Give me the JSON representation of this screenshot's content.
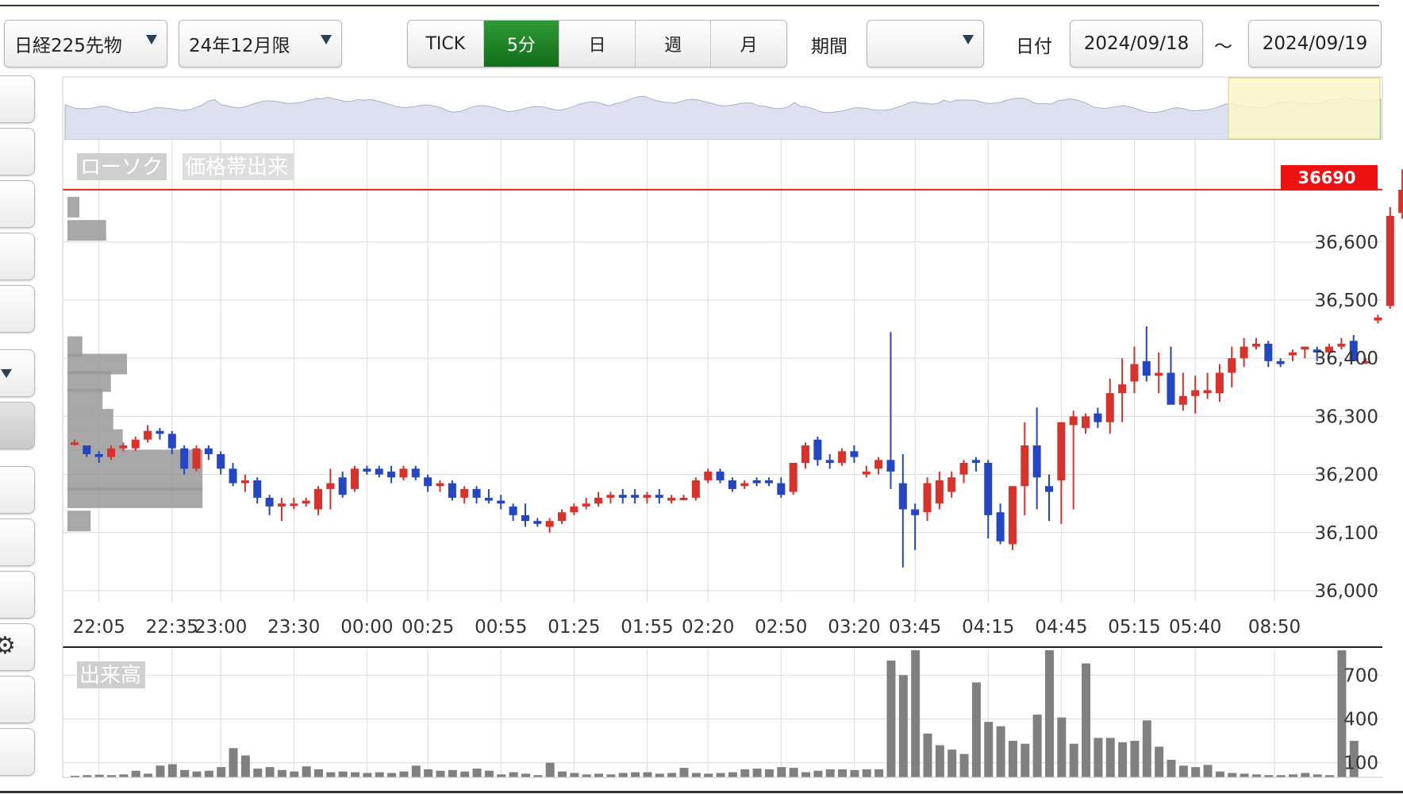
{
  "toolbar": {
    "instrument": "日経225先物",
    "contract_month": "24年12月限",
    "interval_buttons": [
      "TICK",
      "5分",
      "日",
      "週",
      "月"
    ],
    "active_interval": "5分",
    "period_label": "期間",
    "period_value": "",
    "date_label": "日付",
    "date_from": "2024/09/18",
    "date_separator": "～",
    "date_to": "2024/09/19"
  },
  "colors": {
    "up_candle": "#d8322b",
    "down_candle": "#2446c2",
    "active_button": "#1b7d24",
    "last_price_tag": "#ee1111",
    "volume_bar": "#808080",
    "navigator_highlight": "#f8f7c8"
  },
  "chart_data": [
    {
      "type": "candlestick",
      "tags": [
        "ローソク",
        "価格帯出来"
      ],
      "y_ticks": [
        36000,
        36100,
        36200,
        36300,
        36400,
        36500,
        36600
      ],
      "y_tick_labels": [
        "36,000",
        "36,100",
        "36,200",
        "36,300",
        "36,400",
        "36,500",
        "36,600"
      ],
      "ylim": [
        35980,
        36765
      ],
      "x_tick_labels": [
        "22:05",
        "22:35",
        "23:00",
        "23:30",
        "00:00",
        "00:25",
        "00:55",
        "01:25",
        "01:55",
        "02:20",
        "02:50",
        "03:20",
        "03:45",
        "04:15",
        "04:45",
        "05:15",
        "05:40",
        "08:50"
      ],
      "last_price": 36690,
      "last_price_label": "36690",
      "grid": true,
      "candles": [
        [
          36255,
          36260,
          36250,
          36255
        ],
        [
          36250,
          36250,
          36230,
          36235
        ],
        [
          36235,
          36240,
          36220,
          36230
        ],
        [
          36230,
          36250,
          36225,
          36245
        ],
        [
          36245,
          36255,
          36240,
          36250
        ],
        [
          36245,
          36265,
          36240,
          36260
        ],
        [
          36260,
          36285,
          36255,
          36275
        ],
        [
          36275,
          36280,
          36260,
          36270
        ],
        [
          36270,
          36275,
          36235,
          36245
        ],
        [
          36245,
          36250,
          36200,
          36210
        ],
        [
          36210,
          36250,
          36205,
          36245
        ],
        [
          36245,
          36250,
          36225,
          36235
        ],
        [
          36235,
          36240,
          36200,
          36210
        ],
        [
          36210,
          36220,
          36180,
          36185
        ],
        [
          36185,
          36200,
          36170,
          36190
        ],
        [
          36190,
          36195,
          36150,
          36160
        ],
        [
          36160,
          36165,
          36130,
          36145
        ],
        [
          36145,
          36160,
          36120,
          36150
        ],
        [
          36150,
          36160,
          36140,
          36150
        ],
        [
          36150,
          36160,
          36145,
          36155
        ],
        [
          36140,
          36180,
          36130,
          36175
        ],
        [
          36175,
          36210,
          36140,
          36185
        ],
        [
          36195,
          36205,
          36160,
          36165
        ],
        [
          36175,
          36215,
          36170,
          36210
        ],
        [
          36210,
          36215,
          36200,
          36205
        ],
        [
          36210,
          36215,
          36195,
          36200
        ],
        [
          36205,
          36215,
          36185,
          36195
        ],
        [
          36195,
          36215,
          36190,
          36210
        ],
        [
          36210,
          36215,
          36190,
          36195
        ],
        [
          36195,
          36200,
          36170,
          36180
        ],
        [
          36180,
          36190,
          36170,
          36185
        ],
        [
          36185,
          36190,
          36155,
          36160
        ],
        [
          36160,
          36180,
          36150,
          36175
        ],
        [
          36175,
          36180,
          36150,
          36160
        ],
        [
          36160,
          36175,
          36150,
          36155
        ],
        [
          36155,
          36165,
          36140,
          36150
        ],
        [
          36145,
          36150,
          36120,
          36130
        ],
        [
          36130,
          36150,
          36110,
          36120
        ],
        [
          36120,
          36125,
          36110,
          36115
        ],
        [
          36110,
          36125,
          36100,
          36120
        ],
        [
          36120,
          36140,
          36115,
          36135
        ],
        [
          36135,
          36150,
          36130,
          36145
        ],
        [
          36145,
          36160,
          36140,
          36150
        ],
        [
          36150,
          36170,
          36145,
          36160
        ],
        [
          36160,
          36170,
          36150,
          36165
        ],
        [
          36165,
          36175,
          36150,
          36160
        ],
        [
          36165,
          36175,
          36150,
          36160
        ],
        [
          36160,
          36170,
          36150,
          36165
        ],
        [
          36165,
          36175,
          36150,
          36160
        ],
        [
          36155,
          36165,
          36150,
          36160
        ],
        [
          36160,
          36165,
          36155,
          36160
        ],
        [
          36160,
          36195,
          36155,
          36190
        ],
        [
          36190,
          36210,
          36185,
          36205
        ],
        [
          36205,
          36210,
          36185,
          36190
        ],
        [
          36190,
          36195,
          36170,
          36175
        ],
        [
          36180,
          36190,
          36175,
          36185
        ],
        [
          36190,
          36195,
          36180,
          36185
        ],
        [
          36190,
          36195,
          36180,
          36185
        ],
        [
          36185,
          36195,
          36160,
          36165
        ],
        [
          36170,
          36220,
          36165,
          36220
        ],
        [
          36220,
          36255,
          36210,
          36250
        ],
        [
          36260,
          36265,
          36215,
          36225
        ],
        [
          36225,
          36235,
          36210,
          36220
        ],
        [
          36220,
          36245,
          36215,
          36240
        ],
        [
          36240,
          36250,
          36220,
          36230
        ],
        [
          36200,
          36215,
          36195,
          36205
        ],
        [
          36210,
          36230,
          36200,
          36225
        ],
        [
          36225,
          36445,
          36175,
          36205
        ],
        [
          36185,
          36235,
          36040,
          36140
        ],
        [
          36140,
          36150,
          36070,
          36130
        ],
        [
          36135,
          36195,
          36120,
          36185
        ],
        [
          36150,
          36205,
          36140,
          36190
        ],
        [
          36170,
          36205,
          36160,
          36195
        ],
        [
          36200,
          36225,
          36185,
          36220
        ],
        [
          36225,
          36230,
          36205,
          36220
        ],
        [
          36220,
          36225,
          36090,
          36130
        ],
        [
          36135,
          36150,
          36080,
          36085
        ],
        [
          36080,
          36180,
          36070,
          36180
        ],
        [
          36180,
          36290,
          36130,
          36250
        ],
        [
          36250,
          36315,
          36140,
          36195
        ],
        [
          36180,
          36200,
          36120,
          36170
        ],
        [
          36190,
          36240,
          36115,
          36290
        ],
        [
          36285,
          36310,
          36140,
          36300
        ],
        [
          36280,
          36305,
          36270,
          36300
        ],
        [
          36305,
          36315,
          36280,
          36290
        ],
        [
          36290,
          36365,
          36270,
          36340
        ],
        [
          36340,
          36400,
          36290,
          36355
        ],
        [
          36360,
          36420,
          36340,
          36390
        ],
        [
          36395,
          36455,
          36360,
          36370
        ],
        [
          36370,
          36410,
          36340,
          36375
        ],
        [
          36375,
          36420,
          36325,
          36320
        ],
        [
          36320,
          36375,
          36310,
          36335
        ],
        [
          36335,
          36370,
          36305,
          36345
        ],
        [
          36340,
          36375,
          36330,
          36345
        ],
        [
          36340,
          36390,
          36325,
          36375
        ],
        [
          36375,
          36420,
          36350,
          36400
        ],
        [
          36400,
          36435,
          36385,
          36420
        ],
        [
          36420,
          36435,
          36415,
          36425
        ],
        [
          36425,
          36430,
          36385,
          36395
        ],
        [
          36395,
          36400,
          36385,
          36390
        ],
        [
          36405,
          36415,
          36395,
          36410
        ],
        [
          36415,
          36420,
          36400,
          36420
        ],
        [
          36415,
          36420,
          36395,
          36410
        ],
        [
          36410,
          36425,
          36405,
          36420
        ],
        [
          36420,
          36435,
          36415,
          36425
        ],
        [
          36430,
          36440,
          36395,
          36395
        ],
        [
          36395,
          36400,
          36390,
          36395
        ],
        [
          36465,
          36475,
          36460,
          36470
        ],
        [
          36490,
          36660,
          36485,
          36645
        ],
        [
          36650,
          36725,
          36640,
          36690
        ]
      ],
      "price_band_volume": [
        {
          "price": 36660,
          "volume": 20
        },
        {
          "price": 36620,
          "volume": 65
        },
        {
          "price": 36420,
          "volume": 25
        },
        {
          "price": 36390,
          "volume": 100
        },
        {
          "price": 36360,
          "volume": 73
        },
        {
          "price": 36330,
          "volume": 59
        },
        {
          "price": 36295,
          "volume": 77
        },
        {
          "price": 36260,
          "volume": 93
        },
        {
          "price": 36225,
          "volume": 227
        },
        {
          "price": 36190,
          "volume": 227
        },
        {
          "price": 36160,
          "volume": 227
        },
        {
          "price": 36120,
          "volume": 39
        }
      ]
    },
    {
      "type": "bar",
      "tag": "出来高",
      "y_ticks": [
        100,
        400,
        700
      ],
      "y_tick_labels": [
        "100",
        "400",
        "700"
      ],
      "ylim": [
        0,
        870
      ],
      "values": [
        10,
        15,
        18,
        15,
        20,
        45,
        25,
        80,
        90,
        50,
        40,
        45,
        70,
        200,
        150,
        60,
        70,
        50,
        40,
        75,
        55,
        35,
        40,
        35,
        30,
        35,
        30,
        40,
        80,
        55,
        45,
        50,
        40,
        60,
        45,
        20,
        35,
        25,
        15,
        100,
        40,
        30,
        20,
        25,
        20,
        30,
        35,
        35,
        25,
        30,
        65,
        30,
        25,
        30,
        35,
        55,
        60,
        55,
        70,
        65,
        35,
        45,
        55,
        55,
        50,
        55,
        55,
        800,
        700,
        870,
        300,
        220,
        190,
        160,
        650,
        380,
        350,
        250,
        230,
        430,
        870,
        410,
        230,
        780,
        270,
        270,
        240,
        250,
        390,
        210,
        120,
        80,
        70,
        85,
        40,
        30,
        25,
        20,
        15,
        15,
        20,
        30,
        20,
        15,
        870,
        250
      ]
    }
  ]
}
